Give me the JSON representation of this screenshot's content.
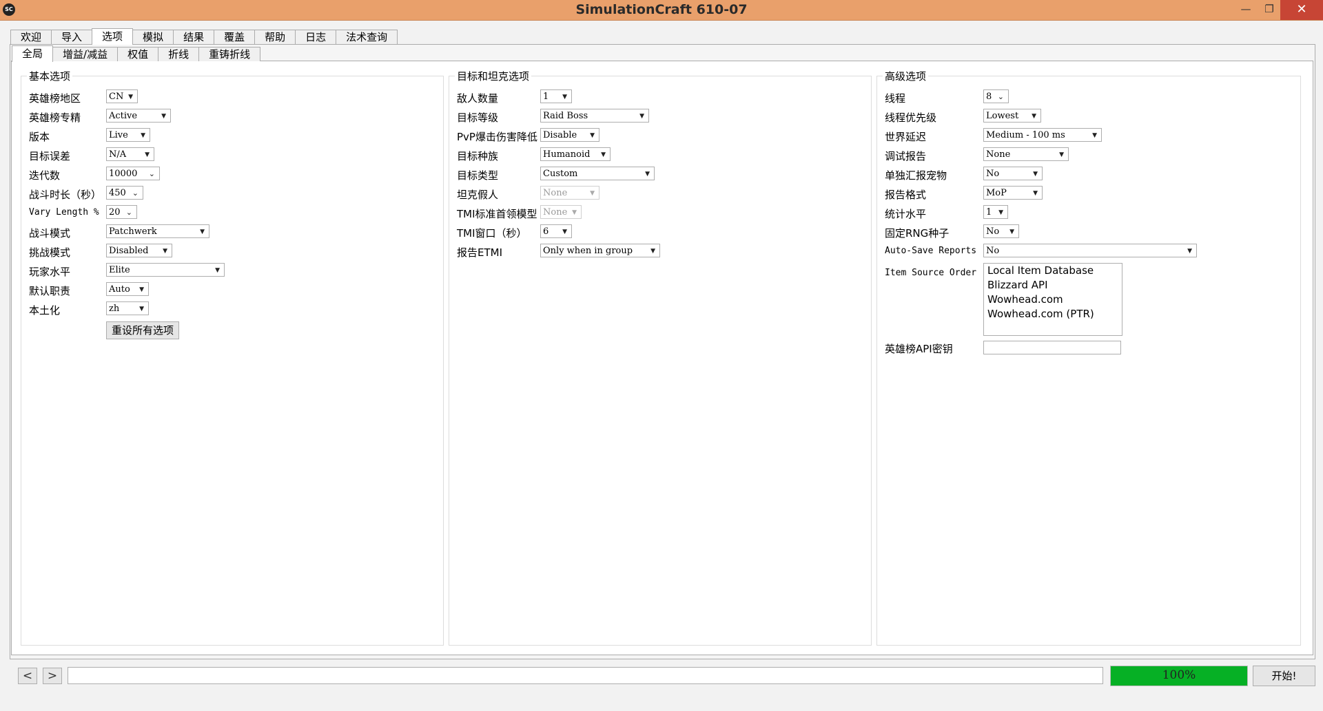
{
  "window": {
    "title": "SimulationCraft 610-07",
    "icon_label": "SC",
    "minimize_symbol": "—",
    "maximize_symbol": "❐",
    "close_symbol": "✕"
  },
  "main_tabs": [
    "欢迎",
    "导入",
    "选项",
    "模拟",
    "结果",
    "覆盖",
    "帮助",
    "日志",
    "法术查询"
  ],
  "sub_tabs": [
    "全局",
    "增益/减益",
    "权值",
    "折线",
    "重铸折线"
  ],
  "basic": {
    "title": "基本选项",
    "rows": [
      {
        "label": "英雄榜地区",
        "value": "CN"
      },
      {
        "label": "英雄榜专精",
        "value": "Active"
      },
      {
        "label": "版本",
        "value": "Live"
      },
      {
        "label": "目标误差",
        "value": "N/A"
      },
      {
        "label": "迭代数",
        "value": "10000"
      },
      {
        "label": "战斗时长（秒）",
        "value": "450"
      },
      {
        "label": "Vary Length %",
        "value": "20"
      },
      {
        "label": "战斗模式",
        "value": "Patchwerk"
      },
      {
        "label": "挑战模式",
        "value": "Disabled"
      },
      {
        "label": "玩家水平",
        "value": "Elite"
      },
      {
        "label": "默认职责",
        "value": "Auto"
      },
      {
        "label": "本土化",
        "value": "zh"
      }
    ],
    "reset_button": "重设所有选项"
  },
  "target": {
    "title": "目标和坦克选项",
    "rows": [
      {
        "label": "敌人数量",
        "value": "1"
      },
      {
        "label": "目标等级",
        "value": "Raid Boss"
      },
      {
        "label": "PvP爆击伤害降低",
        "value": "Disable"
      },
      {
        "label": "目标种族",
        "value": "Humanoid"
      },
      {
        "label": "目标类型",
        "value": "Custom"
      },
      {
        "label": "坦克假人",
        "value": "None"
      },
      {
        "label": "TMI标准首领模型",
        "value": "None"
      },
      {
        "label": "TMI窗口（秒）",
        "value": "6"
      },
      {
        "label": "报告ETMI",
        "value": "Only when in group"
      }
    ]
  },
  "advanced": {
    "title": "高级选项",
    "rows": [
      {
        "label": "线程",
        "value": "8"
      },
      {
        "label": "线程优先级",
        "value": "Lowest"
      },
      {
        "label": "世界延迟",
        "value": "Medium - 100 ms"
      },
      {
        "label": "调试报告",
        "value": "None"
      },
      {
        "label": "单独汇报宠物",
        "value": "No"
      },
      {
        "label": "报告格式",
        "value": "MoP"
      },
      {
        "label": "统计水平",
        "value": "1"
      },
      {
        "label": "固定RNG种子",
        "value": "No"
      },
      {
        "label": "Auto-Save Reports",
        "value": "No"
      }
    ],
    "item_source_label": "Item Source Order",
    "item_sources": [
      "Local Item Database",
      "Blizzard API",
      "Wowhead.com",
      "Wowhead.com (PTR)"
    ],
    "api_key_label": "英雄榜API密钥",
    "api_key_value": ""
  },
  "bottom": {
    "back_symbol": "<",
    "forward_symbol": ">",
    "url_value": "",
    "progress_percent": 100,
    "progress_label": "100%",
    "start_button": "开始!"
  }
}
